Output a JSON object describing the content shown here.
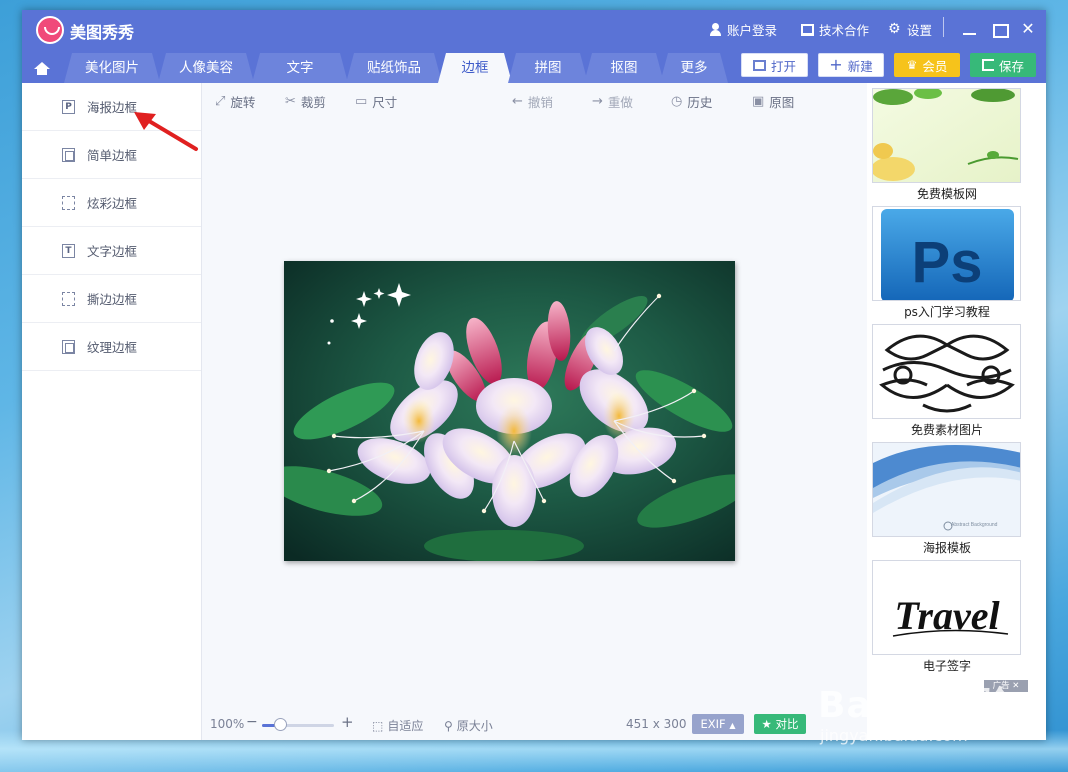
{
  "app": {
    "title": "美图秀秀",
    "header_buttons": {
      "login": "账户登录",
      "cooperation": "技术合作",
      "settings": "设置"
    }
  },
  "tabs": [
    {
      "label": "美化图片"
    },
    {
      "label": "人像美容"
    },
    {
      "label": "文字"
    },
    {
      "label": "贴纸饰品"
    },
    {
      "label": "边框",
      "active": true
    },
    {
      "label": "拼图"
    },
    {
      "label": "抠图"
    },
    {
      "label": "更多"
    }
  ],
  "actions": {
    "open": "打开",
    "new": "新建",
    "vip": "会员",
    "save": "保存"
  },
  "left_menu": [
    {
      "label": "海报边框",
      "icon": "P"
    },
    {
      "label": "简单边框",
      "icon": ""
    },
    {
      "label": "炫彩边框",
      "icon": ""
    },
    {
      "label": "文字边框",
      "icon": "T"
    },
    {
      "label": "撕边边框",
      "icon": ""
    },
    {
      "label": "纹理边框",
      "icon": ""
    }
  ],
  "toolbar": {
    "rotate": "旋转",
    "crop": "裁剪",
    "size": "尺寸",
    "undo": "撤销",
    "redo": "重做",
    "history": "历史",
    "original": "原图"
  },
  "status": {
    "zoom": "100%",
    "zoom_fraction": 0.25,
    "fit": "自适应",
    "actual_size": "原大小",
    "image_size": "451 x 300",
    "exif": "EXIF",
    "compare": "对比"
  },
  "right_panel": [
    {
      "caption": "免费模板网"
    },
    {
      "caption": "ps入门学习教程"
    },
    {
      "caption": "免费素材图片"
    },
    {
      "caption": "海报模板"
    },
    {
      "caption": "电子签字"
    }
  ],
  "thumb_texts": {
    "ps_logo": "Ps",
    "abstract": "Abstract Background",
    "travel": "Travel"
  },
  "ad_badge": "广告",
  "watermark": {
    "brand": "Baidu经验",
    "url": "jingyan.baidu.com"
  },
  "colors": {
    "title_bar": "#5a73d6",
    "accent": "#3e5bc9",
    "vip": "#f6c31b",
    "save": "#37b979",
    "annotation_arrow": "#e02020"
  }
}
